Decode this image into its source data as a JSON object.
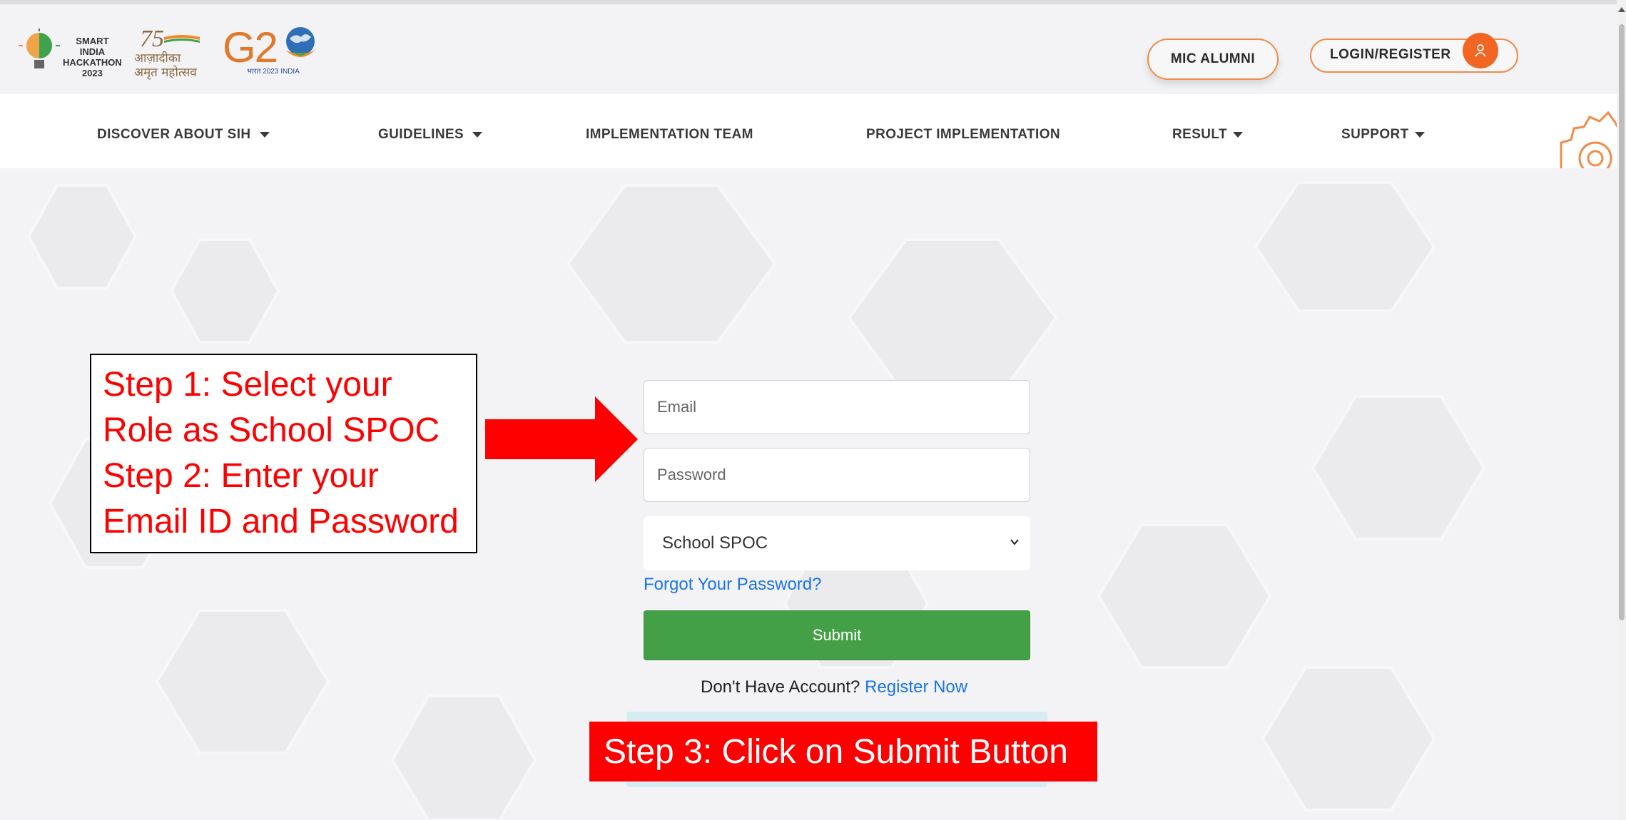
{
  "header": {
    "sih_logo_text": [
      "SMART INDIA",
      "HACKATHON",
      "2023"
    ],
    "azadi_logo_number": "75",
    "azadi_logo_text": [
      "आज़ादीका",
      "अमृत महोत्सव"
    ],
    "g20_logo_text": "G2",
    "g20_sub_text": "भारत 2023 INDIA",
    "alumni_label": "MIC ALUMNI",
    "login_label": "LOGIN/REGISTER"
  },
  "nav": {
    "items": [
      {
        "label": "DISCOVER ABOUT SIH",
        "has_dropdown": true
      },
      {
        "label": "GUIDELINES",
        "has_dropdown": true
      },
      {
        "label": "IMPLEMENTATION TEAM",
        "has_dropdown": false
      },
      {
        "label": "PROJECT IMPLEMENTATION",
        "has_dropdown": false
      },
      {
        "label": "RESULT",
        "has_dropdown": true
      },
      {
        "label": "SUPPORT",
        "has_dropdown": true
      }
    ]
  },
  "form": {
    "email_placeholder": "Email",
    "password_placeholder": "Password",
    "role_selected": "School SPOC",
    "forgot_label": "Forgot Your Password?",
    "submit_label": "Submit",
    "no_account_text": "Don't Have Account?",
    "register_label": "Register Now"
  },
  "annotations": {
    "step1_2_lines": [
      "Step 1: Select your",
      "Role as School SPOC",
      "Step 2: Enter your",
      "Email ID and Password"
    ],
    "step3": "Step 3: Click on Submit Button"
  },
  "colors": {
    "accent_orange": "#f26522",
    "submit_green": "#43a047",
    "link_blue": "#1a73e8",
    "annotation_red": "#ff0000"
  }
}
